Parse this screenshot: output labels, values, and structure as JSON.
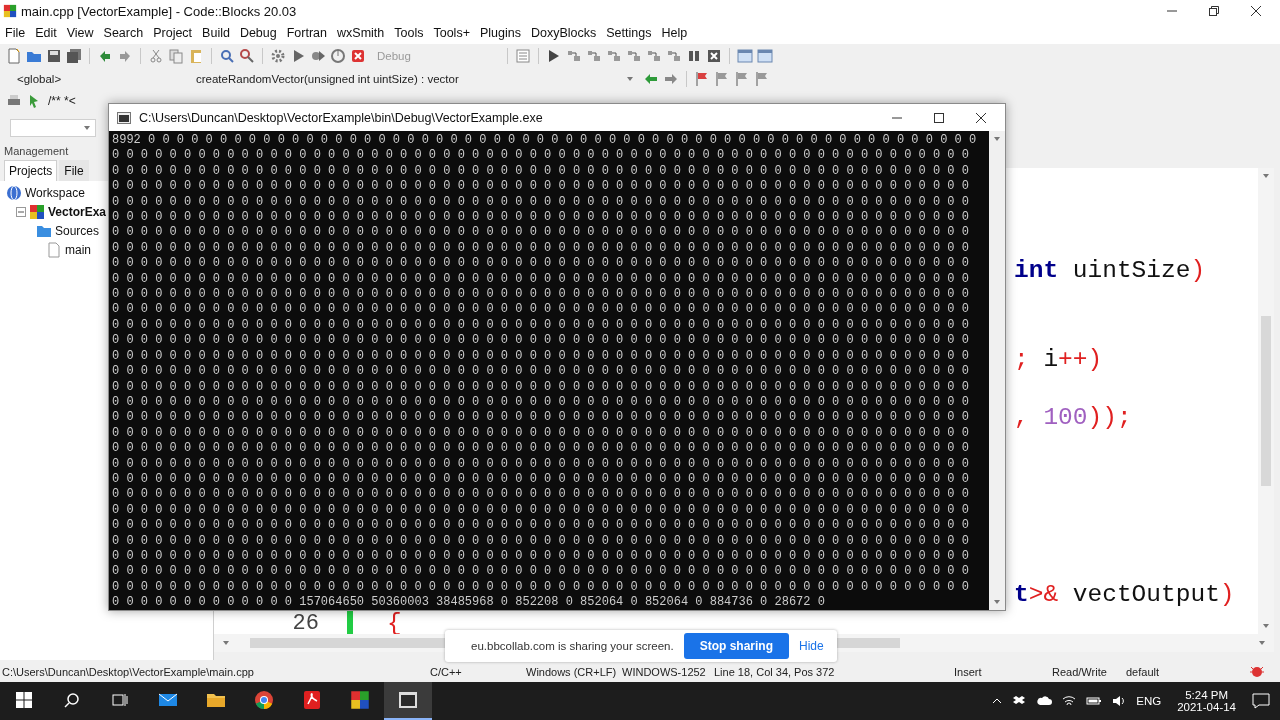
{
  "window": {
    "title": "main.cpp [VectorExample] - Code::Blocks 20.03"
  },
  "menu": [
    "File",
    "Edit",
    "View",
    "Search",
    "Project",
    "Build",
    "Debug",
    "Fortran",
    "wxSmith",
    "Tools",
    "Tools+",
    "Plugins",
    "DoxyBlocks",
    "Settings",
    "Help"
  ],
  "toolbar": {
    "build_target": "Debug",
    "scope": "<global>",
    "symbol": "createRandomVector(unsigned int uintSize) : vector",
    "comment_tool": "/** *<"
  },
  "management": {
    "title": "Management",
    "tabs": [
      {
        "label": "Projects",
        "selected": true
      },
      {
        "label": "File",
        "selected": false
      }
    ],
    "tree": [
      {
        "label": "Workspace",
        "kind": "workspace",
        "children": [
          {
            "label": "VectorExa",
            "kind": "project",
            "expanded": true,
            "children": [
              {
                "label": "Sources",
                "kind": "folder",
                "children": [
                  {
                    "label": "main",
                    "kind": "file"
                  }
                ]
              }
            ]
          }
        ]
      }
    ]
  },
  "editor": {
    "lines": [
      {
        "code": [
          {
            "text": "int",
            "kind": "keyword"
          },
          {
            "text": " uintSize",
            "kind": "plain"
          },
          {
            "text": ")",
            "kind": "operator"
          }
        ]
      },
      {
        "code": [
          {
            "text": ";",
            "kind": "operator"
          },
          {
            "text": " i",
            "kind": "plain"
          },
          {
            "text": "++)",
            "kind": "operator"
          }
        ]
      },
      {
        "code": [
          {
            "text": ",",
            "kind": "operator"
          },
          {
            "text": " 100",
            "kind": "number"
          },
          {
            "text": "));",
            "kind": "operator"
          }
        ]
      },
      {
        "code": [
          {
            "text": "t",
            "kind": "keyword"
          },
          {
            "text": ">&",
            "kind": "operator"
          },
          {
            "text": " vectOutput",
            "kind": "plain"
          },
          {
            "text": ")",
            "kind": "operator"
          }
        ]
      },
      {
        "number": "26",
        "changed": true,
        "code": [
          {
            "text": "{",
            "kind": "operator"
          }
        ]
      }
    ]
  },
  "console": {
    "title": "C:\\Users\\Duncan\\Desktop\\VectorExample\\bin\\Debug\\VectorExample.exe",
    "lines": [
      "8992 0 0 0 0 0 0 0 0 0 0 0 0 0 0 0 0 0 0 0 0 0 0 0 0 0 0 0 0 0 0 0 0 0 0 0 0 0 0 0 0 0 0 0 0 0 0 0 0 0 0 0 0 0 0 0 0 0 0",
      "0 0 0 0 0 0 0 0 0 0 0 0 0 0 0 0 0 0 0 0 0 0 0 0 0 0 0 0 0 0 0 0 0 0 0 0 0 0 0 0 0 0 0 0 0 0 0 0 0 0 0 0 0 0 0 0 0 0 0 0",
      "0 0 0 0 0 0 0 0 0 0 0 0 0 0 0 0 0 0 0 0 0 0 0 0 0 0 0 0 0 0 0 0 0 0 0 0 0 0 0 0 0 0 0 0 0 0 0 0 0 0 0 0 0 0 0 0 0 0 0 0",
      "0 0 0 0 0 0 0 0 0 0 0 0 0 0 0 0 0 0 0 0 0 0 0 0 0 0 0 0 0 0 0 0 0 0 0 0 0 0 0 0 0 0 0 0 0 0 0 0 0 0 0 0 0 0 0 0 0 0 0 0",
      "0 0 0 0 0 0 0 0 0 0 0 0 0 0 0 0 0 0 0 0 0 0 0 0 0 0 0 0 0 0 0 0 0 0 0 0 0 0 0 0 0 0 0 0 0 0 0 0 0 0 0 0 0 0 0 0 0 0 0 0",
      "0 0 0 0 0 0 0 0 0 0 0 0 0 0 0 0 0 0 0 0 0 0 0 0 0 0 0 0 0 0 0 0 0 0 0 0 0 0 0 0 0 0 0 0 0 0 0 0 0 0 0 0 0 0 0 0 0 0 0 0",
      "0 0 0 0 0 0 0 0 0 0 0 0 0 0 0 0 0 0 0 0 0 0 0 0 0 0 0 0 0 0 0 0 0 0 0 0 0 0 0 0 0 0 0 0 0 0 0 0 0 0 0 0 0 0 0 0 0 0 0 0",
      "0 0 0 0 0 0 0 0 0 0 0 0 0 0 0 0 0 0 0 0 0 0 0 0 0 0 0 0 0 0 0 0 0 0 0 0 0 0 0 0 0 0 0 0 0 0 0 0 0 0 0 0 0 0 0 0 0 0 0 0",
      "0 0 0 0 0 0 0 0 0 0 0 0 0 0 0 0 0 0 0 0 0 0 0 0 0 0 0 0 0 0 0 0 0 0 0 0 0 0 0 0 0 0 0 0 0 0 0 0 0 0 0 0 0 0 0 0 0 0 0 0",
      "0 0 0 0 0 0 0 0 0 0 0 0 0 0 0 0 0 0 0 0 0 0 0 0 0 0 0 0 0 0 0 0 0 0 0 0 0 0 0 0 0 0 0 0 0 0 0 0 0 0 0 0 0 0 0 0 0 0 0 0",
      "0 0 0 0 0 0 0 0 0 0 0 0 0 0 0 0 0 0 0 0 0 0 0 0 0 0 0 0 0 0 0 0 0 0 0 0 0 0 0 0 0 0 0 0 0 0 0 0 0 0 0 0 0 0 0 0 0 0 0 0",
      "0 0 0 0 0 0 0 0 0 0 0 0 0 0 0 0 0 0 0 0 0 0 0 0 0 0 0 0 0 0 0 0 0 0 0 0 0 0 0 0 0 0 0 0 0 0 0 0 0 0 0 0 0 0 0 0 0 0 0 0",
      "0 0 0 0 0 0 0 0 0 0 0 0 0 0 0 0 0 0 0 0 0 0 0 0 0 0 0 0 0 0 0 0 0 0 0 0 0 0 0 0 0 0 0 0 0 0 0 0 0 0 0 0 0 0 0 0 0 0 0 0",
      "0 0 0 0 0 0 0 0 0 0 0 0 0 0 0 0 0 0 0 0 0 0 0 0 0 0 0 0 0 0 0 0 0 0 0 0 0 0 0 0 0 0 0 0 0 0 0 0 0 0 0 0 0 0 0 0 0 0 0 0",
      "0 0 0 0 0 0 0 0 0 0 0 0 0 0 0 0 0 0 0 0 0 0 0 0 0 0 0 0 0 0 0 0 0 0 0 0 0 0 0 0 0 0 0 0 0 0 0 0 0 0 0 0 0 0 0 0 0 0 0 0",
      "0 0 0 0 0 0 0 0 0 0 0 0 0 0 0 0 0 0 0 0 0 0 0 0 0 0 0 0 0 0 0 0 0 0 0 0 0 0 0 0 0 0 0 0 0 0 0 0 0 0 0 0 0 0 0 0 0 0 0 0",
      "0 0 0 0 0 0 0 0 0 0 0 0 0 0 0 0 0 0 0 0 0 0 0 0 0 0 0 0 0 0 0 0 0 0 0 0 0 0 0 0 0 0 0 0 0 0 0 0 0 0 0 0 0 0 0 0 0 0 0 0",
      "0 0 0 0 0 0 0 0 0 0 0 0 0 0 0 0 0 0 0 0 0 0 0 0 0 0 0 0 0 0 0 0 0 0 0 0 0 0 0 0 0 0 0 0 0 0 0 0 0 0 0 0 0 0 0 0 0 0 0 0",
      "0 0 0 0 0 0 0 0 0 0 0 0 0 0 0 0 0 0 0 0 0 0 0 0 0 0 0 0 0 0 0 0 0 0 0 0 0 0 0 0 0 0 0 0 0 0 0 0 0 0 0 0 0 0 0 0 0 0 0 0",
      "0 0 0 0 0 0 0 0 0 0 0 0 0 0 0 0 0 0 0 0 0 0 0 0 0 0 0 0 0 0 0 0 0 0 0 0 0 0 0 0 0 0 0 0 0 0 0 0 0 0 0 0 0 0 0 0 0 0 0 0",
      "0 0 0 0 0 0 0 0 0 0 0 0 0 0 0 0 0 0 0 0 0 0 0 0 0 0 0 0 0 0 0 0 0 0 0 0 0 0 0 0 0 0 0 0 0 0 0 0 0 0 0 0 0 0 0 0 0 0 0 0",
      "0 0 0 0 0 0 0 0 0 0 0 0 0 0 0 0 0 0 0 0 0 0 0 0 0 0 0 0 0 0 0 0 0 0 0 0 0 0 0 0 0 0 0 0 0 0 0 0 0 0 0 0 0 0 0 0 0 0 0 0",
      "0 0 0 0 0 0 0 0 0 0 0 0 0 0 0 0 0 0 0 0 0 0 0 0 0 0 0 0 0 0 0 0 0 0 0 0 0 0 0 0 0 0 0 0 0 0 0 0 0 0 0 0 0 0 0 0 0 0 0 0",
      "0 0 0 0 0 0 0 0 0 0 0 0 0 0 0 0 0 0 0 0 0 0 0 0 0 0 0 0 0 0 0 0 0 0 0 0 0 0 0 0 0 0 0 0 0 0 0 0 0 0 0 0 0 0 0 0 0 0 0 0",
      "0 0 0 0 0 0 0 0 0 0 0 0 0 0 0 0 0 0 0 0 0 0 0 0 0 0 0 0 0 0 0 0 0 0 0 0 0 0 0 0 0 0 0 0 0 0 0 0 0 0 0 0 0 0 0 0 0 0 0 0",
      "0 0 0 0 0 0 0 0 0 0 0 0 0 0 0 0 0 0 0 0 0 0 0 0 0 0 0 0 0 0 0 0 0 0 0 0 0 0 0 0 0 0 0 0 0 0 0 0 0 0 0 0 0 0 0 0 0 0 0 0",
      "0 0 0 0 0 0 0 0 0 0 0 0 0 0 0 0 0 0 0 0 0 0 0 0 0 0 0 0 0 0 0 0 0 0 0 0 0 0 0 0 0 0 0 0 0 0 0 0 0 0 0 0 0 0 0 0 0 0 0 0",
      "0 0 0 0 0 0 0 0 0 0 0 0 0 0 0 0 0 0 0 0 0 0 0 0 0 0 0 0 0 0 0 0 0 0 0 0 0 0 0 0 0 0 0 0 0 0 0 0 0 0 0 0 0 0 0 0 0 0 0 0",
      "0 0 0 0 0 0 0 0 0 0 0 0 0 0 0 0 0 0 0 0 0 0 0 0 0 0 0 0 0 0 0 0 0 0 0 0 0 0 0 0 0 0 0 0 0 0 0 0 0 0 0 0 0 0 0 0 0 0 0 0",
      "0 0 0 0 0 0 0 0 0 0 0 0 0 0 0 0 0 0 0 0 0 0 0 0 0 0 0 0 0 0 0 0 0 0 0 0 0 0 0 0 0 0 0 0 0 0 0 0 0 0 0 0 0 0 0 0 0 0 0 0",
      "0 0 0 0 0 0 0 0 0 0 0 0 0 157064650 50360003 38485968 0 852208 0 852064 0 852064 0 884736 0 28672 0"
    ]
  },
  "status_bar": [
    "C:\\Users\\Duncan\\Desktop\\VectorExample\\main.cpp",
    "C/C++",
    "Windows (CR+LF)",
    "WINDOWS-1252",
    "Line 18, Col 34, Pos 372",
    "Insert",
    "Read/Write",
    "default"
  ],
  "screen_share": {
    "message": "eu.bbcollab.com is sharing your screen.",
    "stop": "Stop sharing",
    "hide": "Hide"
  },
  "taskbar": {
    "language": "ENG",
    "time": "5:24 PM",
    "date": "2021-04-14"
  }
}
